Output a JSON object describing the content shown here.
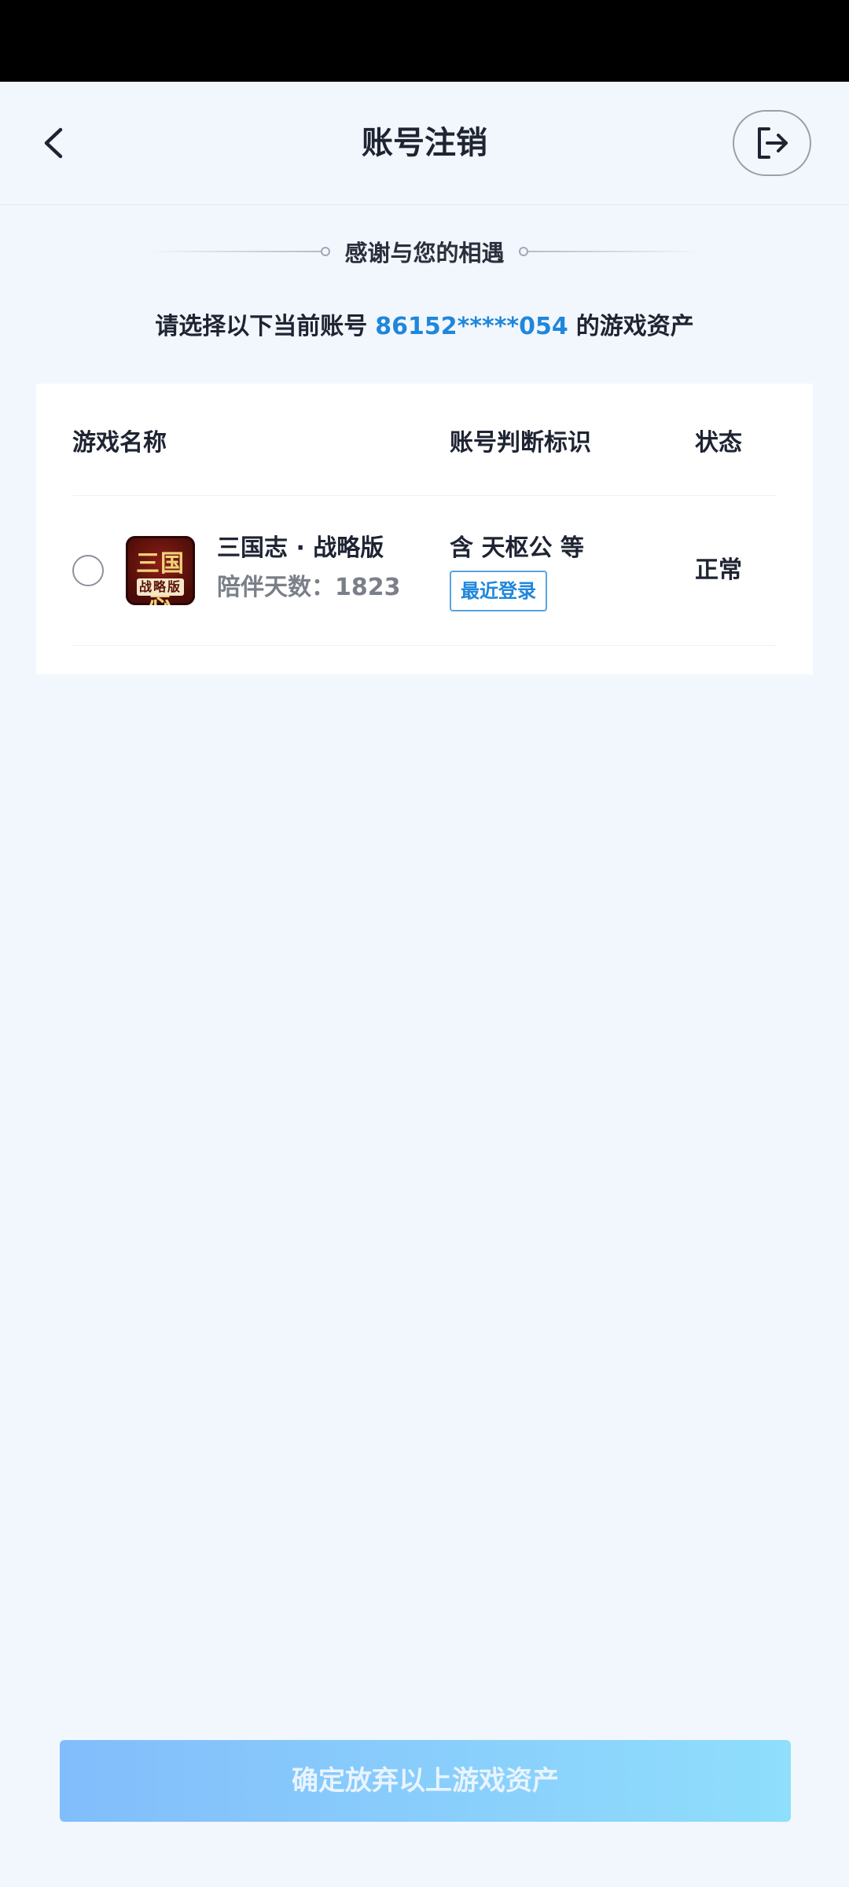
{
  "header": {
    "title": "账号注销"
  },
  "intro": {
    "thanks": "感谢与您的相遇",
    "prompt_prefix": "请选择以下当前账号",
    "account": "86152*****054",
    "prompt_suffix": "的游戏资产"
  },
  "table": {
    "columns": [
      "游戏名称",
      "账号判断标识",
      "状态"
    ],
    "rows": [
      {
        "game_name": "三国志 · 战略版",
        "days": "陪伴天数：1823",
        "identifier": "含 天枢公 等",
        "badge": "最近登录",
        "status": "正常",
        "icon_text_top": "三国志",
        "icon_text_bottom": "战略版"
      }
    ]
  },
  "footer": {
    "confirm_label": "确定放弃以上游戏资产"
  },
  "colors": {
    "accent": "#1f87db",
    "background": "#f2f7fd",
    "button_gradient_start": "#82bdfb",
    "button_gradient_end": "#8fdefc"
  }
}
